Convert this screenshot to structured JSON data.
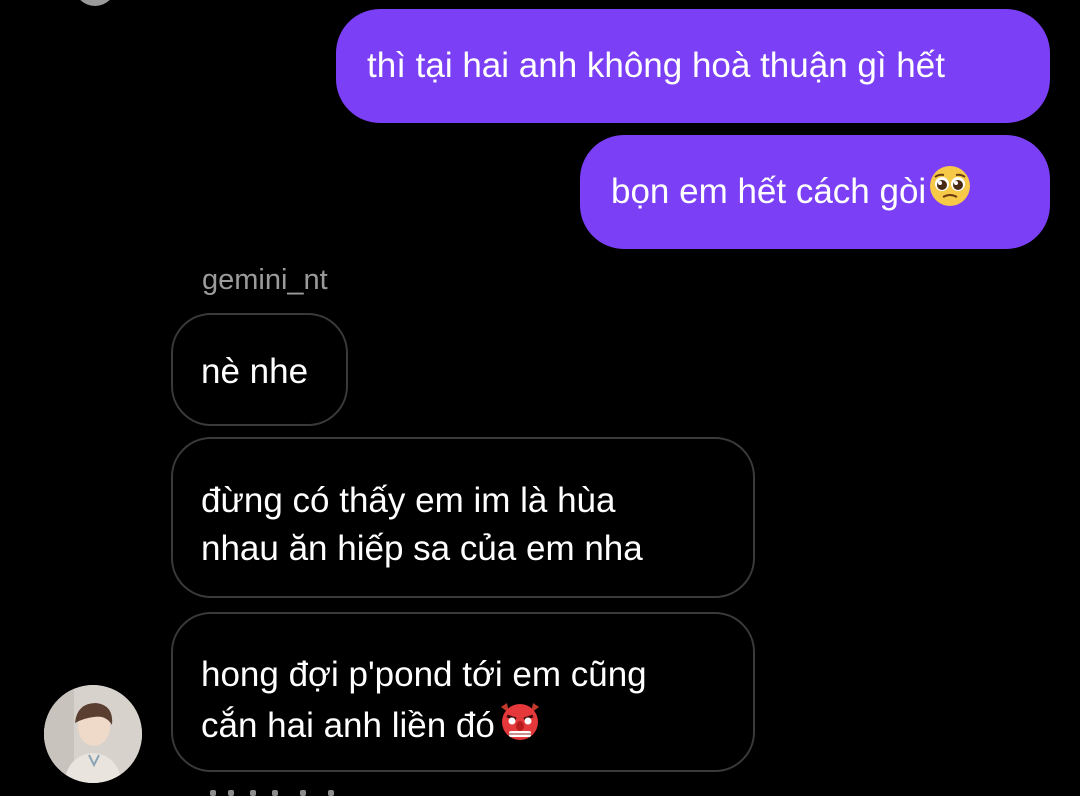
{
  "messages": {
    "sent": [
      {
        "text": "thì tại hai anh không hoà thuận gì hết"
      },
      {
        "text": "bọn em hết cách gòi",
        "emoji": "pleading-face-icon"
      }
    ],
    "sender_name": "gemini_nt",
    "received": [
      {
        "lines": [
          "nè nhe"
        ]
      },
      {
        "lines": [
          "đừng có thấy em im là hùa",
          "nhau ăn hiếp sa của em nha"
        ]
      },
      {
        "lines": [
          "hong đợi p'pond tới em cũng",
          "cắn hai anh liền đó"
        ],
        "emoji": "goblin-mask-icon"
      }
    ]
  },
  "colors": {
    "background": "#000000",
    "sent_bubble": "#7b3ff5",
    "received_border": "#3a3a3a",
    "sender_name": "#9b9b9b"
  }
}
